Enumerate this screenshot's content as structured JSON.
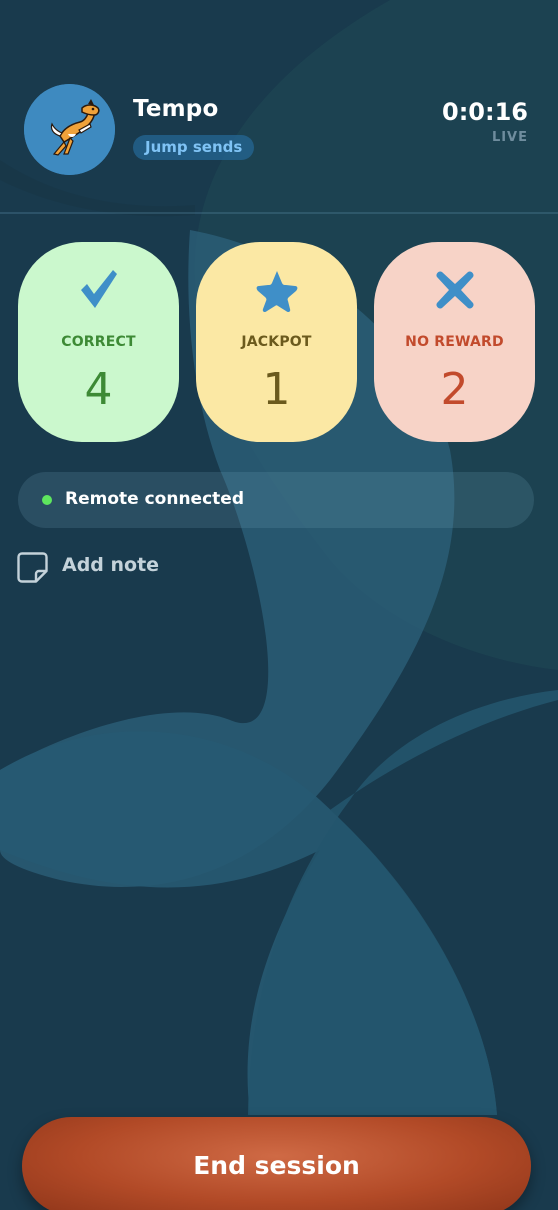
{
  "theme": {
    "background": "#1a3b4e",
    "correct_color": "#3d8a35",
    "jackpot_color": "#6b5a1d",
    "noreward_color": "#c24a2c",
    "end_button_color": "#b24a27",
    "connected_dot_color": "#5ee65e"
  },
  "header": {
    "dog_name": "Tempo",
    "skill": "Jump sends",
    "timer": "0:0:16",
    "status": "LIVE",
    "avatar_icon": "dog-avatar-icon"
  },
  "tallies": [
    {
      "label": "CORRECT",
      "count": "4",
      "icon": "check-icon"
    },
    {
      "label": "JACKPOT",
      "count": "1",
      "icon": "star-icon"
    },
    {
      "label": "NO REWARD",
      "count": "2",
      "icon": "x-icon"
    }
  ],
  "remote": {
    "text": "Remote connected"
  },
  "note": {
    "label": "Add note",
    "icon": "note-icon"
  },
  "footer": {
    "end_label": "End session"
  }
}
